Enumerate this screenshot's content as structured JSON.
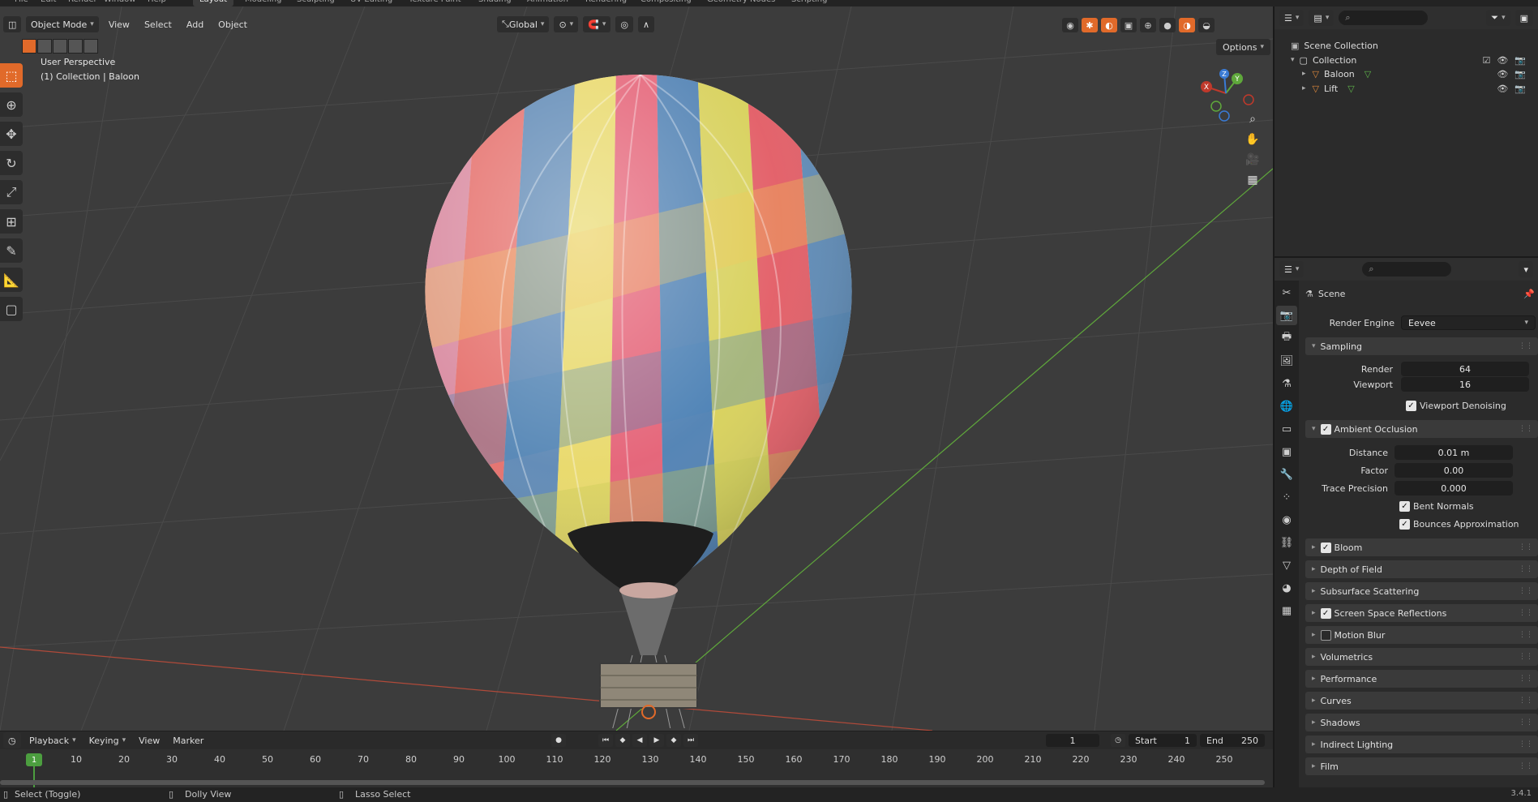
{
  "workspace_tabs": [
    "File",
    "Edit",
    "Render",
    "Window",
    "Help",
    "Layout",
    "Modeling",
    "Sculpting",
    "UV Editing",
    "Texture Paint",
    "Shading",
    "Animation",
    "Rendering",
    "Compositing",
    "Geometry Nodes",
    "Scripting"
  ],
  "active_workspace": "Layout",
  "viewport": {
    "mode": "Object Mode",
    "menus": [
      "View",
      "Select",
      "Add",
      "Object"
    ],
    "orientation": "Global",
    "options_label": "Options",
    "perspective_label": "User Perspective",
    "collection_label": "(1) Collection | Baloon",
    "gizmo_axes": [
      "X",
      "Y",
      "Z"
    ]
  },
  "timeline": {
    "menus": [
      "Playback",
      "Keying",
      "View",
      "Marker"
    ],
    "current_frame": "1",
    "start_label": "Start",
    "start_value": "1",
    "end_label": "End",
    "end_value": "250",
    "ticks": [
      "1",
      "10",
      "20",
      "30",
      "40",
      "50",
      "60",
      "70",
      "80",
      "90",
      "100",
      "110",
      "120",
      "130",
      "140",
      "150",
      "160",
      "170",
      "180",
      "190",
      "200",
      "210",
      "220",
      "230",
      "240",
      "250"
    ]
  },
  "statusbar": {
    "left": "Select (Toggle)",
    "middle": "Dolly View",
    "right": "Lasso Select",
    "version": "3.4.1"
  },
  "outliner": {
    "root": "Scene Collection",
    "collection": "Collection",
    "objects": [
      "Baloon",
      "Lift"
    ]
  },
  "properties": {
    "context": "Scene",
    "render_engine_label": "Render Engine",
    "render_engine": "Eevee",
    "sampling": {
      "title": "Sampling",
      "render_label": "Render",
      "render": "64",
      "viewport_label": "Viewport",
      "viewport": "16",
      "denoise_label": "Viewport Denoising"
    },
    "ao": {
      "title": "Ambient Occlusion",
      "distance_label": "Distance",
      "distance": "0.01 m",
      "factor_label": "Factor",
      "factor": "0.00",
      "trace_label": "Trace Precision",
      "trace": "0.000",
      "bent_label": "Bent Normals",
      "bounces_label": "Bounces Approximation"
    },
    "panels": [
      {
        "label": "Bloom",
        "checkbox": true,
        "checked": true
      },
      {
        "label": "Depth of Field",
        "checkbox": false
      },
      {
        "label": "Subsurface Scattering",
        "checkbox": false
      },
      {
        "label": "Screen Space Reflections",
        "checkbox": true,
        "checked": true
      },
      {
        "label": "Motion Blur",
        "checkbox": true,
        "checked": false
      },
      {
        "label": "Volumetrics",
        "checkbox": false
      },
      {
        "label": "Performance",
        "checkbox": false
      },
      {
        "label": "Curves",
        "checkbox": false
      },
      {
        "label": "Shadows",
        "checkbox": false
      },
      {
        "label": "Indirect Lighting",
        "checkbox": false
      },
      {
        "label": "Film",
        "checkbox": false
      }
    ]
  },
  "colors": {
    "accent": "#e16a2a",
    "frame_green": "#4c9e3f",
    "axis_x": "#c0392b",
    "axis_y": "#5fa83b"
  }
}
